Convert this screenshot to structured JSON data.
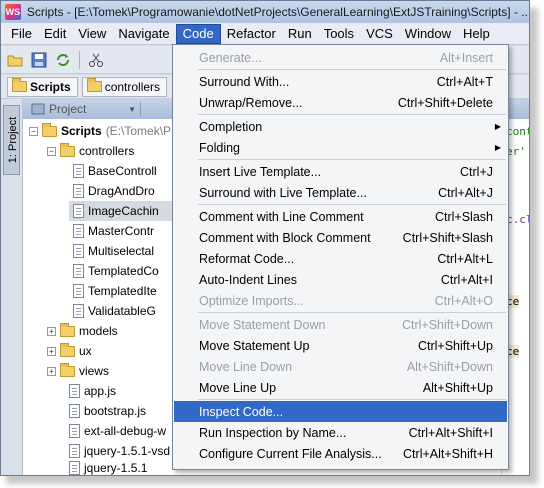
{
  "window": {
    "title": "Scripts - [E:\\Tomek\\Programowanie\\dotNetProjects\\GeneralLearning\\ExtJSTraining\\Scripts] - ...\\"
  },
  "menubar": [
    "File",
    "Edit",
    "View",
    "Navigate",
    "Code",
    "Refactor",
    "Run",
    "Tools",
    "VCS",
    "Window",
    "Help"
  ],
  "toolbar_icons": [
    "open-folder-icon",
    "save-icon",
    "sync-icon",
    "cut-icon"
  ],
  "breadcrumb": [
    "Scripts",
    "controllers"
  ],
  "side_tab": "1: Project",
  "panel": {
    "title": "Project"
  },
  "tree": {
    "root": {
      "name": "Scripts",
      "path": "(E:\\Tomek\\P"
    },
    "controllers": "controllers",
    "controller_files": [
      "BaseControll",
      "DragAndDro",
      "ImageCachin",
      "MasterContr",
      "Multiselectal",
      "TemplatedCo",
      "TemplatedIte",
      "ValidatableG"
    ],
    "folders": [
      "models",
      "ux",
      "views"
    ],
    "files": [
      "app.js",
      "bootstrap.js",
      "ext-all-debug-w",
      "jquery-1.5.1-vsd",
      "jquery-1.5.1"
    ]
  },
  "editor_fragments": [
    "cont",
    "er'",
    "c.cl",
    "ce",
    "ce"
  ],
  "code_menu": [
    {
      "label": "Generate...",
      "shortcut": "Alt+Insert",
      "disabled": true
    },
    {
      "sep": true
    },
    {
      "label": "Surround With...",
      "shortcut": "Ctrl+Alt+T"
    },
    {
      "label": "Unwrap/Remove...",
      "shortcut": "Ctrl+Shift+Delete"
    },
    {
      "sep": true
    },
    {
      "label": "Completion",
      "submenu": true
    },
    {
      "label": "Folding",
      "submenu": true
    },
    {
      "sep": true
    },
    {
      "label": "Insert Live Template...",
      "shortcut": "Ctrl+J"
    },
    {
      "label": "Surround with Live Template...",
      "shortcut": "Ctrl+Alt+J"
    },
    {
      "sep": true
    },
    {
      "label": "Comment with Line Comment",
      "shortcut": "Ctrl+Slash"
    },
    {
      "label": "Comment with Block Comment",
      "shortcut": "Ctrl+Shift+Slash"
    },
    {
      "label": "Reformat Code...",
      "shortcut": "Ctrl+Alt+L"
    },
    {
      "label": "Auto-Indent Lines",
      "shortcut": "Ctrl+Alt+I"
    },
    {
      "label": "Optimize Imports...",
      "shortcut": "Ctrl+Alt+O",
      "disabled": true
    },
    {
      "sep": true
    },
    {
      "label": "Move Statement Down",
      "shortcut": "Ctrl+Shift+Down",
      "disabled": true
    },
    {
      "label": "Move Statement Up",
      "shortcut": "Ctrl+Shift+Up"
    },
    {
      "label": "Move Line Down",
      "shortcut": "Alt+Shift+Down",
      "disabled": true
    },
    {
      "label": "Move Line Up",
      "shortcut": "Alt+Shift+Up"
    },
    {
      "sep": true
    },
    {
      "label": "Inspect Code...",
      "shortcut": "",
      "highlight": true
    },
    {
      "label": "Run Inspection by Name...",
      "shortcut": "Ctrl+Alt+Shift+I"
    },
    {
      "label": "Configure Current File Analysis...",
      "shortcut": "Ctrl+Alt+Shift+H"
    }
  ],
  "colors": {
    "accent": "#3269c6",
    "menu_bg": "#f4f5f7",
    "disabled_text": "#9a9ea6"
  }
}
